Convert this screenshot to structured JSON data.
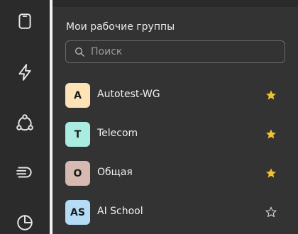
{
  "rail": {
    "items": [
      {
        "name": "tablet-icon"
      },
      {
        "name": "lightning-icon"
      },
      {
        "name": "network-icon"
      },
      {
        "name": "speed-icon"
      },
      {
        "name": "pie-chart-icon"
      }
    ]
  },
  "groups": {
    "title": "Мои рабочие группы",
    "search_placeholder": "Поиск",
    "items": [
      {
        "initial": "A",
        "name": "Autotest-WG",
        "color": "#fde3b6",
        "favorite": true
      },
      {
        "initial": "T",
        "name": "Telecom",
        "color": "#a9ece0",
        "favorite": true
      },
      {
        "initial": "О",
        "name": "Общая",
        "color": "#d6b9b0",
        "favorite": true
      },
      {
        "initial": "AS",
        "name": "AI School",
        "color": "#b5dcf6",
        "favorite": false
      }
    ]
  },
  "colors": {
    "star_active": "#f2c12e",
    "star_inactive": "#d0d0d0",
    "icon": "#e6e6e6"
  }
}
